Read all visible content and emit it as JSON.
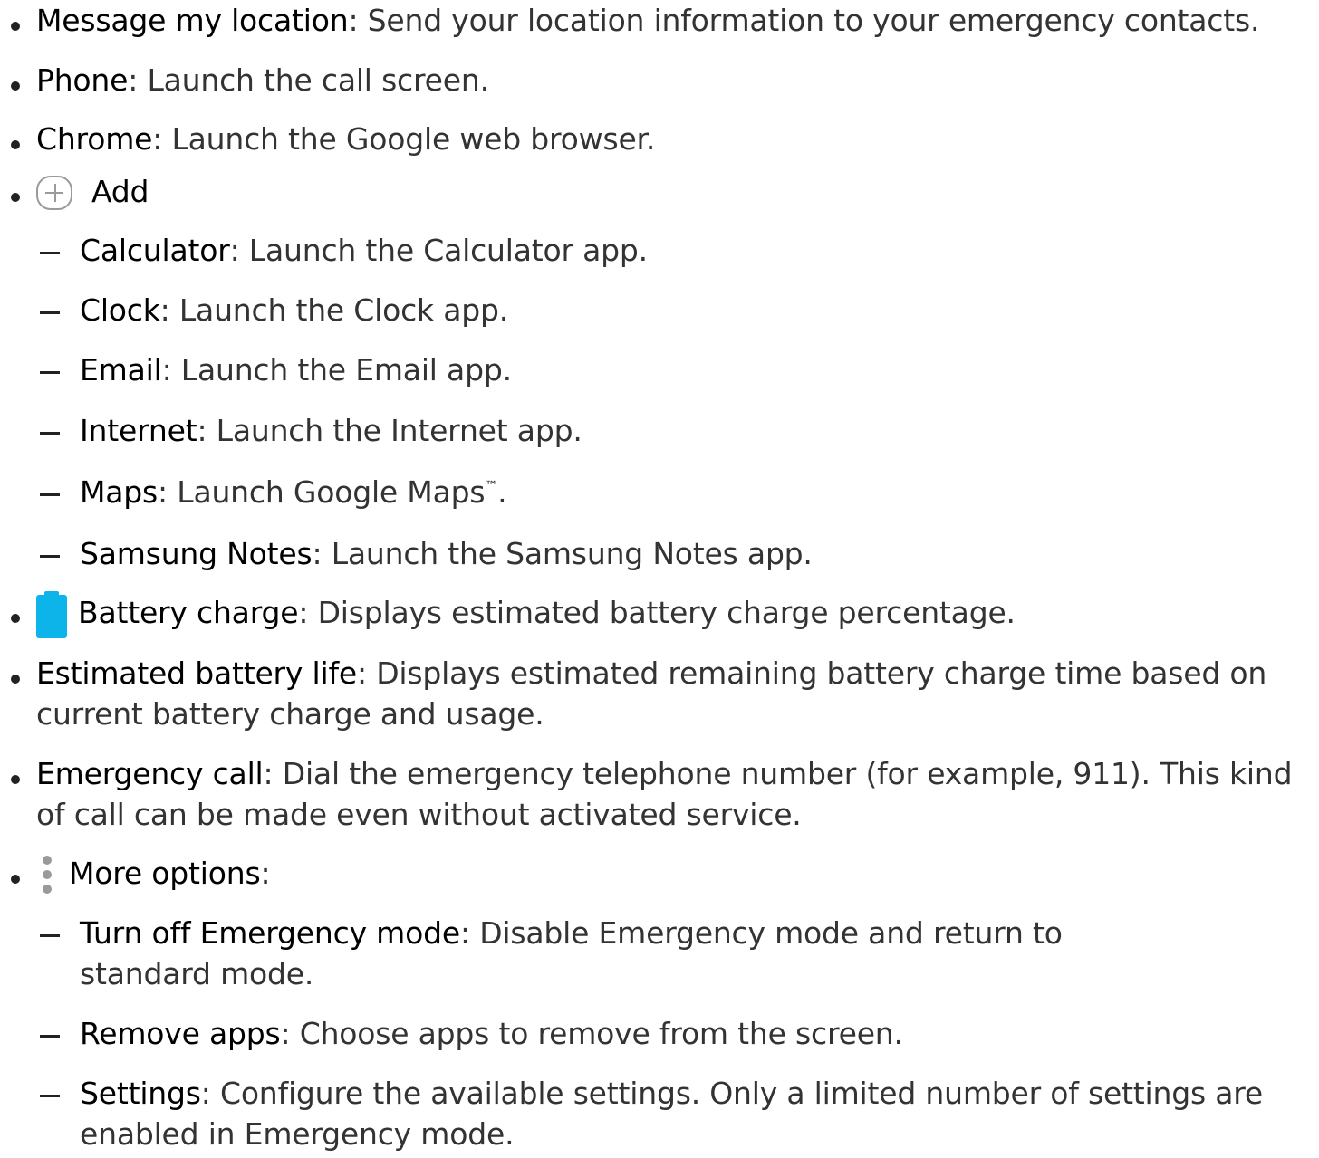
{
  "items": [
    {
      "term": "Message my location",
      "desc": ": Send your location information to your emergency contacts."
    },
    {
      "term": "Phone",
      "desc": ": Launch the call screen."
    },
    {
      "term": "Chrome",
      "desc": ": Launch the Google web browser."
    },
    {
      "icon": "add-icon",
      "term": "Add",
      "desc": ""
    },
    {
      "sub": true,
      "term": "Calculator",
      "desc": ": Launch the Calculator app."
    },
    {
      "sub": true,
      "term": "Clock",
      "desc": ": Launch the Clock app."
    },
    {
      "sub": true,
      "term": "Email",
      "desc": ": Launch the Email app."
    },
    {
      "sub": true,
      "term": "Internet",
      "desc": ": Launch the Internet app."
    },
    {
      "sub": true,
      "term": "Maps",
      "desc": ": Launch Google Maps",
      "trademark": "™",
      "desc_end": "."
    },
    {
      "sub": true,
      "term": "Samsung Notes",
      "desc": ": Launch the Samsung Notes app."
    },
    {
      "icon": "battery-icon",
      "term": "Battery charge",
      "desc": ": Displays estimated battery charge percentage."
    },
    {
      "term": "Estimated battery life",
      "desc": ": Displays estimated remaining battery charge time based on",
      "line2": "current battery charge and usage."
    },
    {
      "term": "Emergency call",
      "desc": ": Dial the emergency telephone number (for example, 911). This kind",
      "line2": "of call can be made even without activated service."
    },
    {
      "icon": "more-options-icon",
      "term": "More options",
      "desc": ":"
    },
    {
      "sub": true,
      "term": "Turn off Emergency mode",
      "desc": ": Disable Emergency mode and return to",
      "line2": "standard mode."
    },
    {
      "sub": true,
      "term": "Remove apps",
      "desc": ": Choose apps to remove from the screen."
    },
    {
      "sub": true,
      "term": "Settings",
      "desc": ": Configure the available settings. Only a limited number of settings are",
      "line2": "enabled in Emergency mode."
    }
  ],
  "colors": {
    "text": "#222222",
    "battery_icon": "#0db4ea",
    "gray_icon": "#9a9a9a"
  }
}
